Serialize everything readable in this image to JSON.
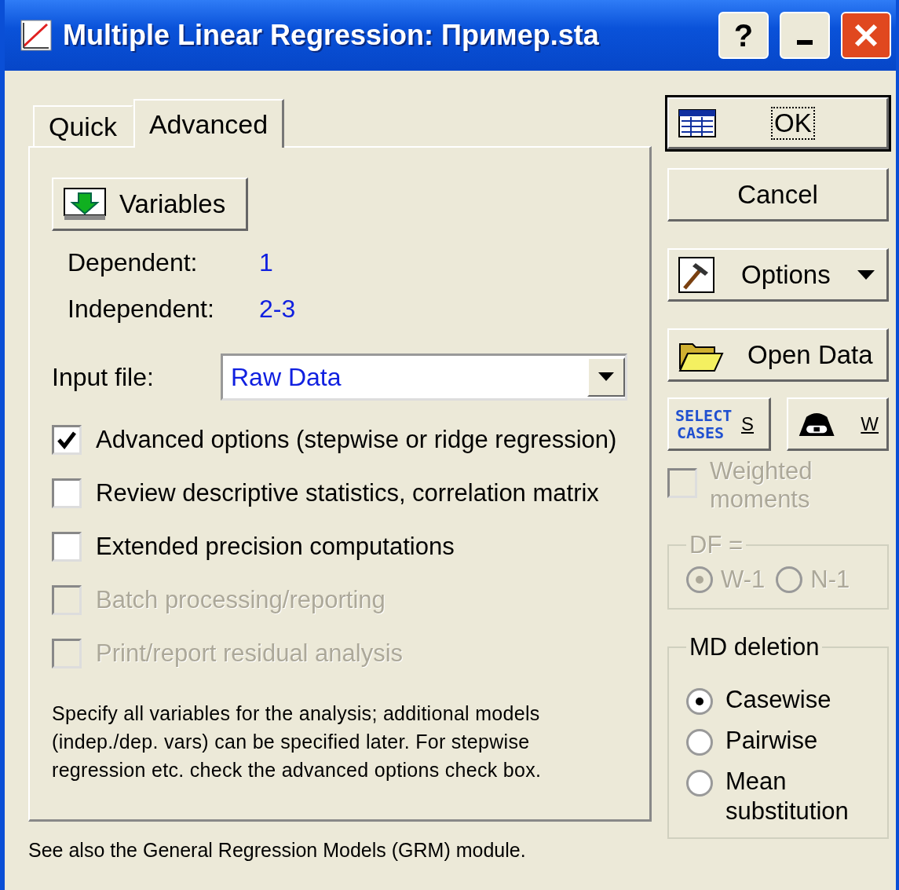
{
  "window": {
    "title": "Multiple Linear Regression: Пример.sta",
    "help_button": "?"
  },
  "tabs": [
    {
      "label": "Quick",
      "selected": false
    },
    {
      "label": "Advanced",
      "selected": true
    }
  ],
  "variables_button": {
    "label": "Variables"
  },
  "dependent": {
    "label": "Dependent:",
    "value": "1"
  },
  "independent": {
    "label": "Independent:",
    "value": "2-3"
  },
  "input_file": {
    "label": "Input file:",
    "value": "Raw Data"
  },
  "checkboxes": [
    {
      "label": "Advanced options (stepwise or ridge regression)",
      "checked": true,
      "disabled": false
    },
    {
      "label": "Review descriptive statistics, correlation matrix",
      "checked": false,
      "disabled": false
    },
    {
      "label": "Extended precision computations",
      "checked": false,
      "disabled": false
    },
    {
      "label": "Batch processing/reporting",
      "checked": false,
      "disabled": true
    },
    {
      "label": "Print/report residual analysis",
      "checked": false,
      "disabled": true
    }
  ],
  "note": "Specify all variables for the analysis; additional models (indep./dep. vars) can be specified later.  For stepwise regression etc. check the advanced options check box.",
  "footer": "See also the General Regression Models (GRM) module.",
  "ok_button": {
    "label": "OK",
    "default": true
  },
  "cancel_button": {
    "label": "Cancel"
  },
  "options_button": {
    "label": "Options"
  },
  "open_data_button": {
    "label": "Open Data"
  },
  "select_cases_button": {
    "icon_text": "SELECT CASES",
    "key": "S"
  },
  "weight_button": {
    "key": "W"
  },
  "weighted_moments": {
    "label": "Weighted moments",
    "checked": false,
    "disabled": true
  },
  "df": {
    "label": "DF =",
    "disabled": true,
    "options": [
      {
        "label": "W-1",
        "selected": true
      },
      {
        "label": "N-1",
        "selected": false
      }
    ]
  },
  "md_deletion": {
    "label": "MD deletion",
    "options": [
      {
        "label": "Casewise",
        "selected": true
      },
      {
        "label": "Pairwise",
        "selected": false
      },
      {
        "label": "Mean substitution",
        "selected": false
      }
    ]
  }
}
